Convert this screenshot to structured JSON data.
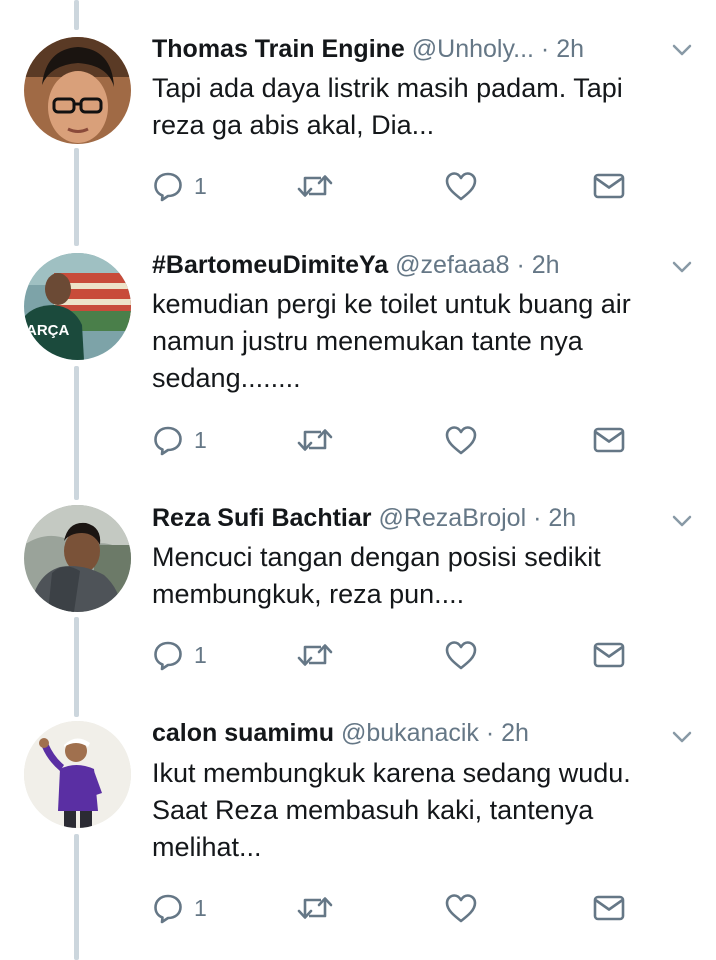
{
  "tweets": [
    {
      "name": "Thomas Train Engine",
      "handle": "@Unholy...",
      "time": "2h",
      "text_lines": [
        "Tapi ada daya listrik masih padam. Tapi",
        "reza ga abis akal, Dia..."
      ],
      "reply_count": "1",
      "avatar_icon": "man-with-glasses-avatar"
    },
    {
      "name": "#BartomeuDimiteYa",
      "handle": "@zefaaa8",
      "time": "2h",
      "text_lines": [
        "kemudian pergi ke toilet untuk buang air",
        "namun justru menemukan tante nya",
        "sedang........"
      ],
      "reply_count": "1",
      "avatar_icon": "stadium-fan-avatar",
      "avatar_text": "ARÇA"
    },
    {
      "name": "Reza Sufi Bachtiar",
      "handle": "@RezaBrojol",
      "time": "2h",
      "text_lines": [
        "Mencuci tangan dengan posisi sedikit",
        "membungkuk, reza pun...."
      ],
      "reply_count": "1",
      "avatar_icon": "hooded-man-avatar"
    },
    {
      "name": "calon suamimu",
      "handle": "@bukanacik",
      "time": "2h",
      "text_lines": [
        "Ikut membungkuk karena sedang wudu.",
        "Saat Reza membasuh kaki, tantenya",
        "melihat..."
      ],
      "reply_count": "1",
      "avatar_icon": "man-in-purple-shirt-avatar"
    }
  ],
  "dot": "·",
  "colors": {
    "icon_gray": "#657786",
    "thread_line": "#ccd6dd",
    "text": "#14171a"
  }
}
